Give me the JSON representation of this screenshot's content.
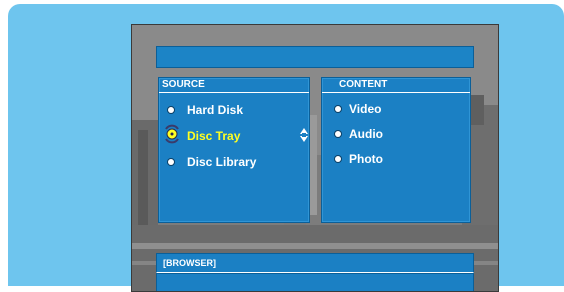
{
  "colors": {
    "frame": "#6ec5ee",
    "panel": "#1b80c4",
    "text": "#ffffff",
    "selected_text": "#ffff22"
  },
  "title_bar": {
    "text": ""
  },
  "source": {
    "header": "SOURCE",
    "items": [
      {
        "label": "Hard Disk",
        "selected": false
      },
      {
        "label": "Disc Tray",
        "selected": true
      },
      {
        "label": "Disc Library",
        "selected": false
      }
    ]
  },
  "content": {
    "header": "CONTENT",
    "items": [
      {
        "label": "Video"
      },
      {
        "label": "Audio"
      },
      {
        "label": "Photo"
      }
    ]
  },
  "browser": {
    "label": "[BROWSER]"
  },
  "icons": {
    "bullet": "bullet-icon",
    "selected": "disc-selector-icon",
    "scroll": "scroll-updown-icon"
  }
}
